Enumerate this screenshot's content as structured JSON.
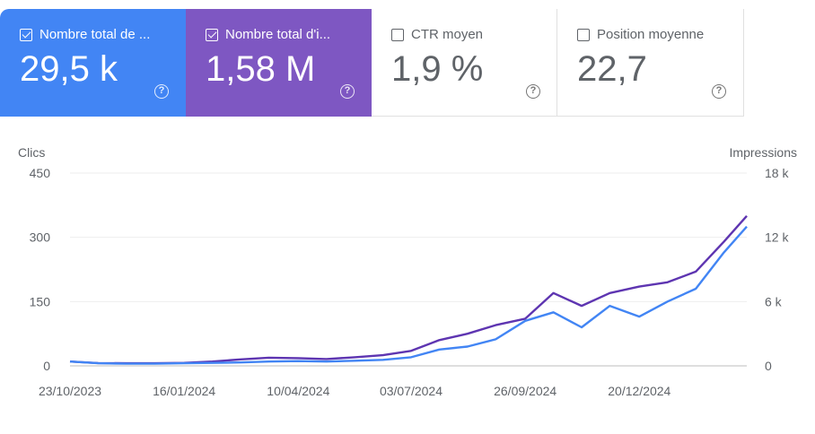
{
  "metrics": [
    {
      "label": "Nombre total de ...",
      "value": "29,5 k",
      "checked": true,
      "color": "#4285f4"
    },
    {
      "label": "Nombre total d'i...",
      "value": "1,58 M",
      "checked": true,
      "color": "#7e57c2"
    },
    {
      "label": "CTR moyen",
      "value": "1,9 %",
      "checked": false
    },
    {
      "label": "Position moyenne",
      "value": "22,7",
      "checked": false
    }
  ],
  "help_icon": "?",
  "chart_data": {
    "type": "line",
    "left_axis_title": "Clics",
    "right_axis_title": "Impressions",
    "left_ticks": [
      "0",
      "150",
      "300",
      "450"
    ],
    "right_ticks": [
      "0",
      "6 k",
      "12 k",
      "18 k"
    ],
    "left_range": [
      0,
      450
    ],
    "right_range": [
      0,
      18000
    ],
    "x_ticks": [
      "23/10/2023",
      "16/01/2024",
      "10/04/2024",
      "03/07/2024",
      "26/09/2024",
      "20/12/2024"
    ],
    "x": [
      "23/10/2023",
      "13/11/2023",
      "04/12/2023",
      "25/12/2023",
      "16/01/2024",
      "06/02/2024",
      "27/02/2024",
      "19/03/2024",
      "10/04/2024",
      "01/05/2024",
      "22/05/2024",
      "12/06/2024",
      "03/07/2024",
      "24/07/2024",
      "14/08/2024",
      "04/09/2024",
      "26/09/2024",
      "17/10/2024",
      "07/11/2024",
      "28/11/2024",
      "20/12/2024",
      "10/01/2025",
      "31/01/2025",
      "21/02/2025",
      "10/03/2025"
    ],
    "series": [
      {
        "name": "Clics",
        "axis": "left",
        "color": "#4285f4",
        "values": [
          10,
          6,
          5,
          5,
          6,
          7,
          8,
          10,
          11,
          10,
          12,
          14,
          20,
          38,
          45,
          62,
          105,
          125,
          90,
          140,
          115,
          150,
          180,
          265,
          325
        ]
      },
      {
        "name": "Impressions",
        "axis": "right",
        "color": "#5e35b1",
        "values": [
          400,
          260,
          240,
          240,
          280,
          400,
          600,
          760,
          720,
          640,
          800,
          1000,
          1400,
          2400,
          3000,
          3800,
          4400,
          6800,
          5600,
          6800,
          7400,
          7800,
          8800,
          11600,
          14000
        ]
      }
    ],
    "grid": true
  }
}
